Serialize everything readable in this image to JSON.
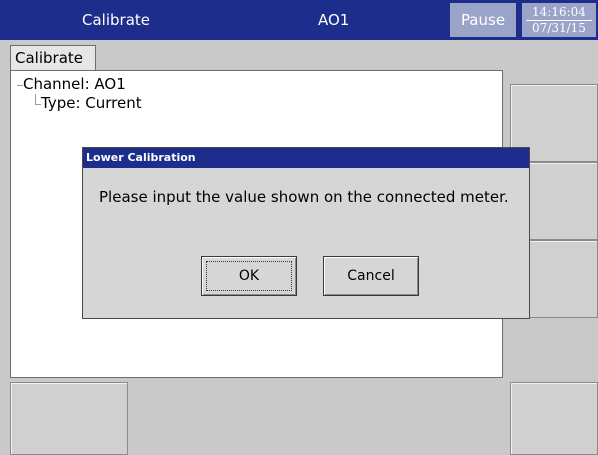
{
  "titlebar": {
    "screen_title": "Calibrate",
    "channel": "AO1",
    "status": "Pause",
    "time": "14:16:04",
    "date": "07/31/15"
  },
  "tab": {
    "label": "Calibrate"
  },
  "tree": {
    "channel": "Channel: AO1",
    "type": "Type: Current"
  },
  "dialog": {
    "title": "Lower Calibration",
    "message": "Please input the value shown on the connected meter.",
    "ok_label": "OK",
    "cancel_label": "Cancel"
  },
  "colors": {
    "titlebar": "#1d2d8c",
    "status_box": "#9aa4c8",
    "background": "#c9c9c9"
  }
}
